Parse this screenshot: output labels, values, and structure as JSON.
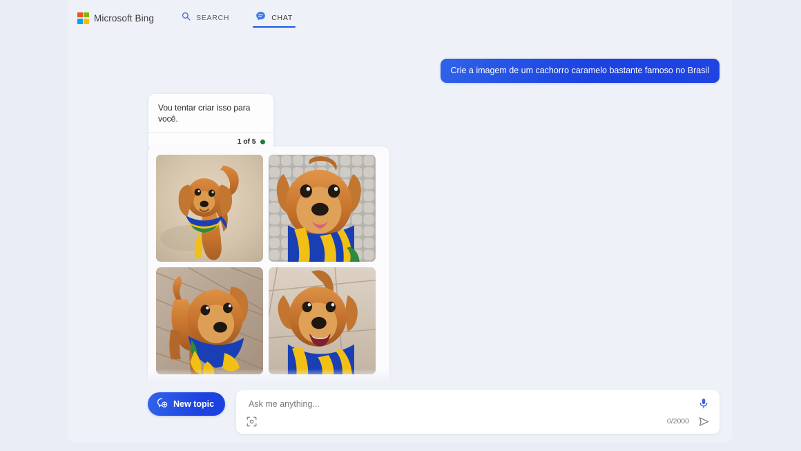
{
  "header": {
    "brand": "Microsoft Bing",
    "logo_colors": [
      "#f25022",
      "#7fba00",
      "#00a4ef",
      "#ffb900"
    ],
    "tabs": [
      {
        "label": "SEARCH",
        "icon": "search-icon",
        "active": false
      },
      {
        "label": "CHAT",
        "icon": "chat-bubble-icon",
        "active": true
      }
    ],
    "accent": "#1b57e0"
  },
  "conversation": {
    "user_message": "Crie a imagem de um cachorro caramelo bastante famoso no Brasil",
    "bot_message": "Vou tentar criar isso para você.",
    "bot_counter": "1 of 5",
    "bot_status_color": "#1a7a39",
    "images_caption": "\"A famous caramel dog in Brazil\"",
    "images": [
      {
        "alt": "caramel dog with blue and yellow scarf standing on sand, tail up"
      },
      {
        "alt": "caramel puppy with blue and yellow scarf on cobblestone, looking up"
      },
      {
        "alt": "caramel puppy with blue and yellow bandana on patterned wood floor"
      },
      {
        "alt": "caramel dog smiling with blue and yellow scarf on tiled floor"
      }
    ]
  },
  "composer": {
    "new_topic_label": "New topic",
    "new_topic_icon": "new-chat-icon",
    "input_placeholder": "Ask me anything...",
    "input_value": "",
    "char_count": "0/2000",
    "mic_icon": "microphone-icon",
    "visual_search_icon": "visual-search-icon",
    "send_icon": "send-icon",
    "accent": "#1b42e0"
  }
}
